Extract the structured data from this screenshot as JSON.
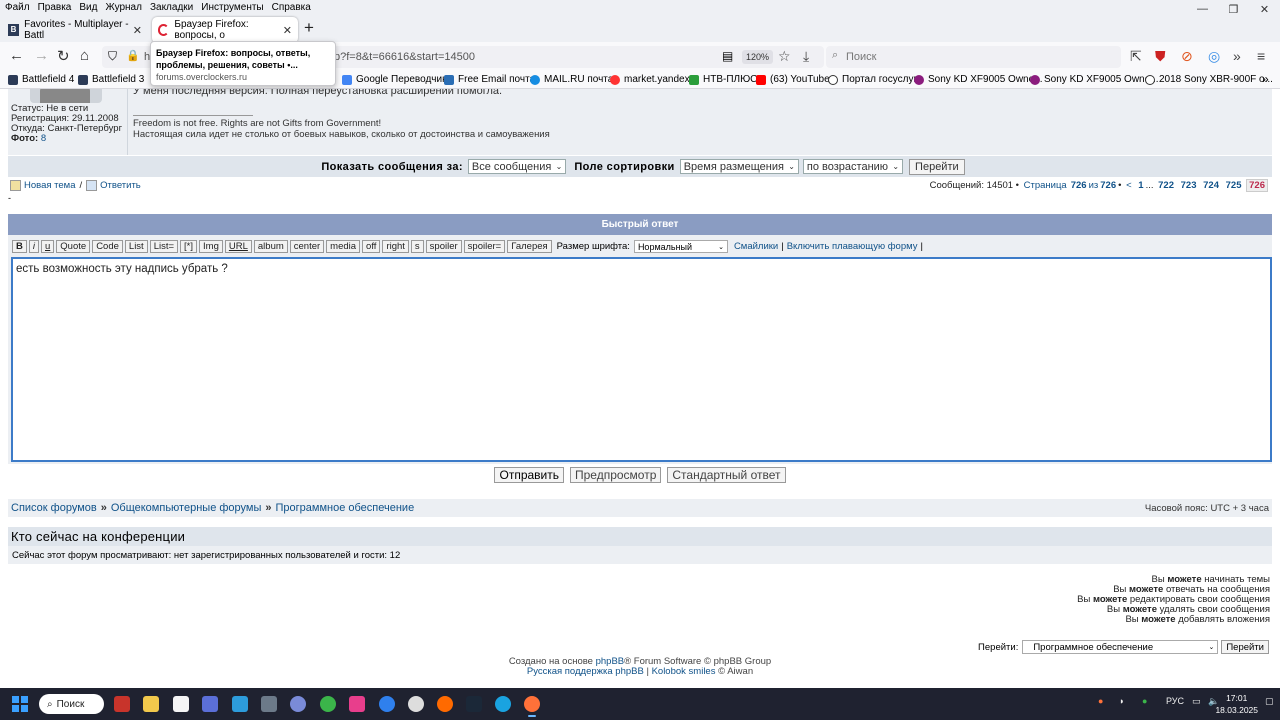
{
  "browser": {
    "menu": [
      "Файл",
      "Правка",
      "Вид",
      "Журнал",
      "Закладки",
      "Инструменты",
      "Справка"
    ],
    "tabs": [
      {
        "label": "Favorites - Multiplayer - Battl",
        "active": false
      },
      {
        "label": "Браузер Firefox: вопросы, о",
        "active": true
      }
    ],
    "url_visible": "h",
    "url_tail": "p?f=8&t=66616&start=14500",
    "zoom": "120%",
    "search_placeholder": "Поиск",
    "bookmarks": [
      "Battlefield 4",
      "Battlefield 3",
      "Google Переводчик",
      "Free Email почта",
      "MAIL.RU почта",
      "market.yandex",
      "НТВ-ПЛЮС",
      "(63) YouTube",
      "Портал госуслуг",
      "Sony KD XF9005 Owne...",
      "Sony KD XF9005 Owne...",
      "2018 Sony XBR-900F o..."
    ],
    "tooltip": {
      "title": "Браузер Firefox: вопросы, ответы, проблемы, решения, советы •...",
      "host": "forums.overclockers.ru"
    }
  },
  "profile": {
    "status": "Статус: Не в сети",
    "registered": "Регистрация: 29.11.2008",
    "from": "Откуда: Санкт-Петербург",
    "photo_label": "Фото:",
    "photo_count": "8",
    "post_text": "У меня последняя версия. Полная переустановка расширений помогла.",
    "sig1": "Freedom is not free. Rights are not Gifts from Government!",
    "sig2": "Настоящая сила идет не столько от боевых навыков, сколько от достоинства и самоуважения"
  },
  "sort": {
    "show_label": "Показать сообщения за:",
    "show_value": "Все сообщения",
    "field_label": "Поле сортировки",
    "field_value": "Время размещения",
    "order_value": "по возрастанию",
    "go": "Перейти"
  },
  "actions": {
    "new_topic": "Новая тема",
    "slash": "/",
    "reply": "Ответить"
  },
  "pagination": {
    "prefix": "Сообщений: 14501 •",
    "page_word": "Страница",
    "page": "726",
    "of": "из",
    "total": "726",
    "bullet": "•",
    "prev": "<",
    "first": "1",
    "ellipsis": "...",
    "pages": [
      "722",
      "723",
      "724",
      "725"
    ],
    "current": "726"
  },
  "dash": "-",
  "quick_reply": {
    "header": "Быстрый ответ",
    "buttons": [
      "B",
      "i",
      "u",
      "Quote",
      "Code",
      "List",
      "List=",
      "[*]",
      "Img",
      "URL",
      "album",
      "center",
      "media",
      "off",
      "right",
      "s",
      "spoiler",
      "spoiler=",
      "Галерея"
    ],
    "font_size_label": "Размер шрифта:",
    "font_size_value": "Нормальный",
    "smilies": "Смайлики",
    "pipe": "|",
    "float_form": "Включить плавающую форму",
    "message": "есть возможность эту надпись убрать ?"
  },
  "submit": {
    "send": "Отправить",
    "preview": "Предпросмотр",
    "full": "Стандартный ответ"
  },
  "breadcrumb": {
    "items": [
      "Список форумов",
      "Общекомпьютерные форумы",
      "Программное обеспечение"
    ],
    "sep": "»",
    "timezone": "Часовой пояс: UTC + 3 часа"
  },
  "online": {
    "heading": "Кто сейчас на конференции",
    "text": "Сейчас этот форум просматривают: нет зарегистрированных пользователей и гости: 12"
  },
  "permissions": {
    "you": "Вы",
    "can": "можете",
    "items": [
      "начинать темы",
      "отвечать на сообщения",
      "редактировать свои сообщения",
      "удалять свои сообщения",
      "добавлять вложения"
    ]
  },
  "jump": {
    "label": "Перейти:",
    "value": "Программное обеспечение",
    "button": "Перейти"
  },
  "footer": {
    "line1_a": "Создано на основе",
    "phpbb": "phpBB",
    "line1_b": "® Forum Software © phpBB Group",
    "support": "Русская поддержка phpBB",
    "kolobok": "Kolobok smiles",
    "aiwan": "© Aiwan"
  },
  "taskbar": {
    "search": "Поиск",
    "lang": "РУС",
    "time": "17:01",
    "date": "18.03.2025"
  }
}
